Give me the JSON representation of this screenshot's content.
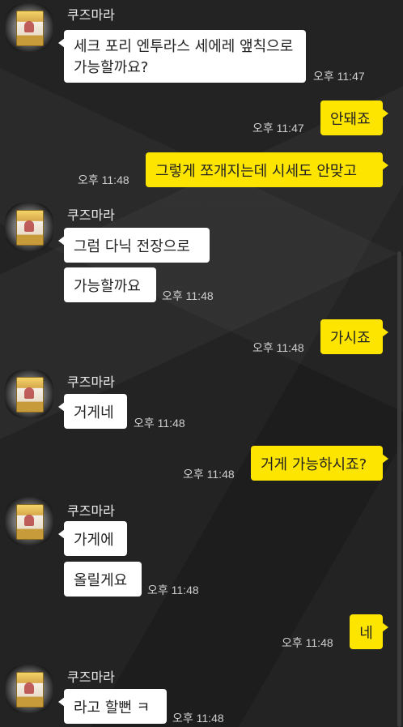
{
  "sender_name": "쿠즈마라",
  "messages": [
    {
      "text": "세크 포리 엔투라스 세에레 앺칙으로 가능할까요?",
      "time": "오후 11:47"
    },
    {
      "text": "안돼죠",
      "time": "오후 11:47"
    },
    {
      "text": "그렇게 쪼개지는데 시세도 안맞고",
      "time": "오후 11:48"
    },
    {
      "text": "그럼 다닉 전장으로",
      "time": ""
    },
    {
      "text": "가능할까요",
      "time": "오후 11:48"
    },
    {
      "text": "가시죠",
      "time": "오후 11:48"
    },
    {
      "text": "거게네",
      "time": "오후 11:48"
    },
    {
      "text": "거게 가능하시죠?",
      "time": "오후 11:48"
    },
    {
      "text": "가게에",
      "time": ""
    },
    {
      "text": "올릴게요",
      "time": "오후 11:48"
    },
    {
      "text": "네",
      "time": "오후 11:48"
    },
    {
      "text": "라고 할뻔 ㅋ",
      "time": "오후 11:48"
    }
  ],
  "colors": {
    "background": "#232323",
    "incoming_bubble": "#ffffff",
    "outgoing_bubble": "#fee500",
    "text_light": "#eaeaea"
  }
}
